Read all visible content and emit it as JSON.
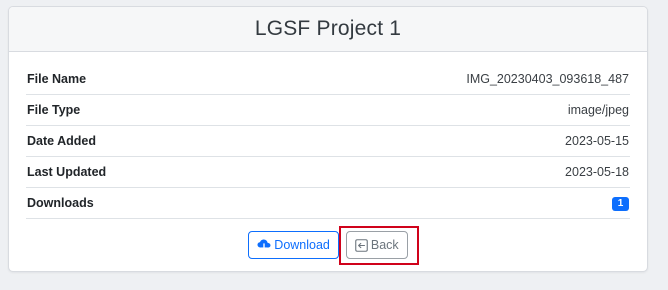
{
  "header": {
    "title": "LGSF Project 1"
  },
  "details": [
    {
      "label": "File Name",
      "value": "IMG_20230403_093618_487"
    },
    {
      "label": "File Type",
      "value": "image/jpeg"
    },
    {
      "label": "Date Added",
      "value": "2023-05-15"
    },
    {
      "label": "Last Updated",
      "value": "2023-05-18"
    },
    {
      "label": "Downloads",
      "value": "1"
    }
  ],
  "actions": {
    "download_label": "Download",
    "download_icon": "cloud-download-icon",
    "back_label": "Back",
    "back_icon": "arrow-left-square-icon"
  },
  "colors": {
    "primary": "#0d6efd",
    "secondary": "#6c757d",
    "highlight": "#d0021b"
  }
}
